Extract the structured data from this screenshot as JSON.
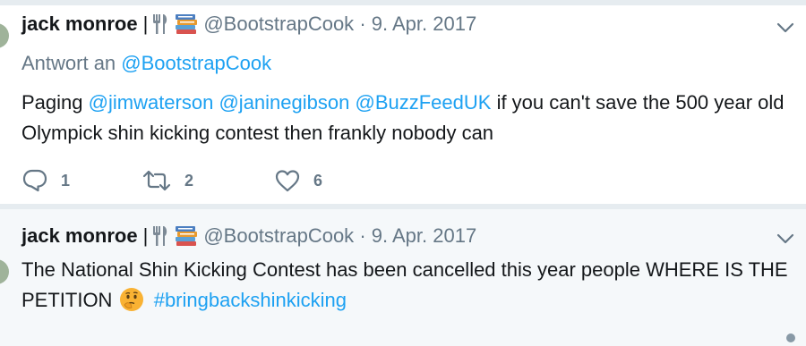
{
  "tweets": [
    {
      "name": "jack monroe",
      "separator": "|",
      "handle": "@BootstrapCook",
      "meta": "· 9. Apr. 2017",
      "reply_prefix": "Antwort an",
      "reply_handle": "@BootstrapCook",
      "text_intro": "Paging",
      "mention_1": "@jimwaterson",
      "mention_2": "@janinegibson",
      "mention_3": "@BuzzFeedUK",
      "text_rest": "if you can't save the 500 year old Olympick shin kicking contest then frankly nobody can",
      "replies": "1",
      "retweets": "2",
      "likes": "6"
    },
    {
      "name": "jack monroe",
      "separator": "|",
      "handle": "@BootstrapCook",
      "meta": "· 9. Apr. 2017",
      "text": "The National Shin Kicking Contest has been cancelled this year people WHERE IS THE PETITION",
      "hashtag": "#bringbackshinkicking"
    }
  ],
  "icons": {
    "fork_knife": "fork-knife-icon",
    "books": "books-icon",
    "chevron": "chevron-down-icon",
    "reply": "reply-icon",
    "retweet": "retweet-icon",
    "like": "heart-icon",
    "thinking": "thinking-face-icon"
  },
  "colors": {
    "link": "#1da1f2",
    "muted": "#657786",
    "text": "#14171a",
    "divider": "#e6ecf0",
    "background_alt": "#f5f8fa"
  }
}
